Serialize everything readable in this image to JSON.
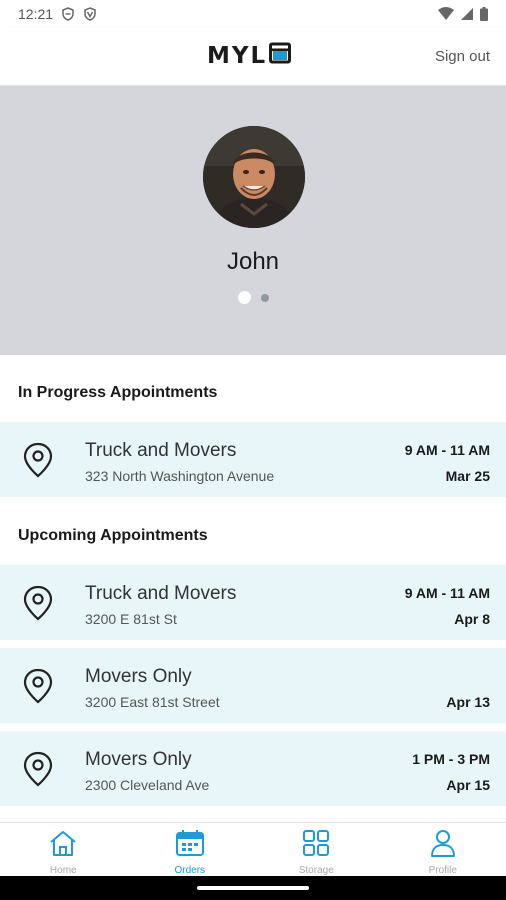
{
  "status_bar": {
    "time": "12:21",
    "icons": [
      "shield-icon",
      "vpn-shield-icon",
      "wifi-icon",
      "cellular-signal-icon",
      "battery-icon"
    ]
  },
  "header": {
    "logo_text": "MYL",
    "logo_icon": "box-icon",
    "sign_out_label": "Sign out"
  },
  "profile": {
    "name": "John",
    "carousel_page": 1,
    "carousel_pages": 2
  },
  "in_progress": {
    "heading": "In Progress Appointments",
    "items": [
      {
        "title": "Truck and Movers",
        "address": "323 North Washington Avenue",
        "time": "9 AM - 11 AM",
        "date": "Mar 25"
      }
    ]
  },
  "upcoming": {
    "heading": "Upcoming Appointments",
    "items": [
      {
        "title": "Truck and Movers",
        "address": "3200 E 81st St",
        "time": "9 AM - 11 AM",
        "date": "Apr 8"
      },
      {
        "title": "Movers Only",
        "address": "3200 East 81st Street",
        "time": "",
        "date": "Apr 13"
      },
      {
        "title": "Movers Only",
        "address": "2300 Cleveland Ave",
        "time": "1 PM - 3 PM",
        "date": "Apr 15"
      }
    ]
  },
  "bottom_nav": {
    "items": [
      {
        "label": "Home",
        "icon": "home-icon",
        "active": false
      },
      {
        "label": "Orders",
        "icon": "calendar-icon",
        "active": true
      },
      {
        "label": "Storage",
        "icon": "grid-icon",
        "active": false
      },
      {
        "label": "Profile",
        "icon": "person-icon",
        "active": false
      }
    ]
  },
  "colors": {
    "accent": "#1e9bd7",
    "card_background": "#e8f6fa",
    "hero_background": "#d4d6db"
  }
}
